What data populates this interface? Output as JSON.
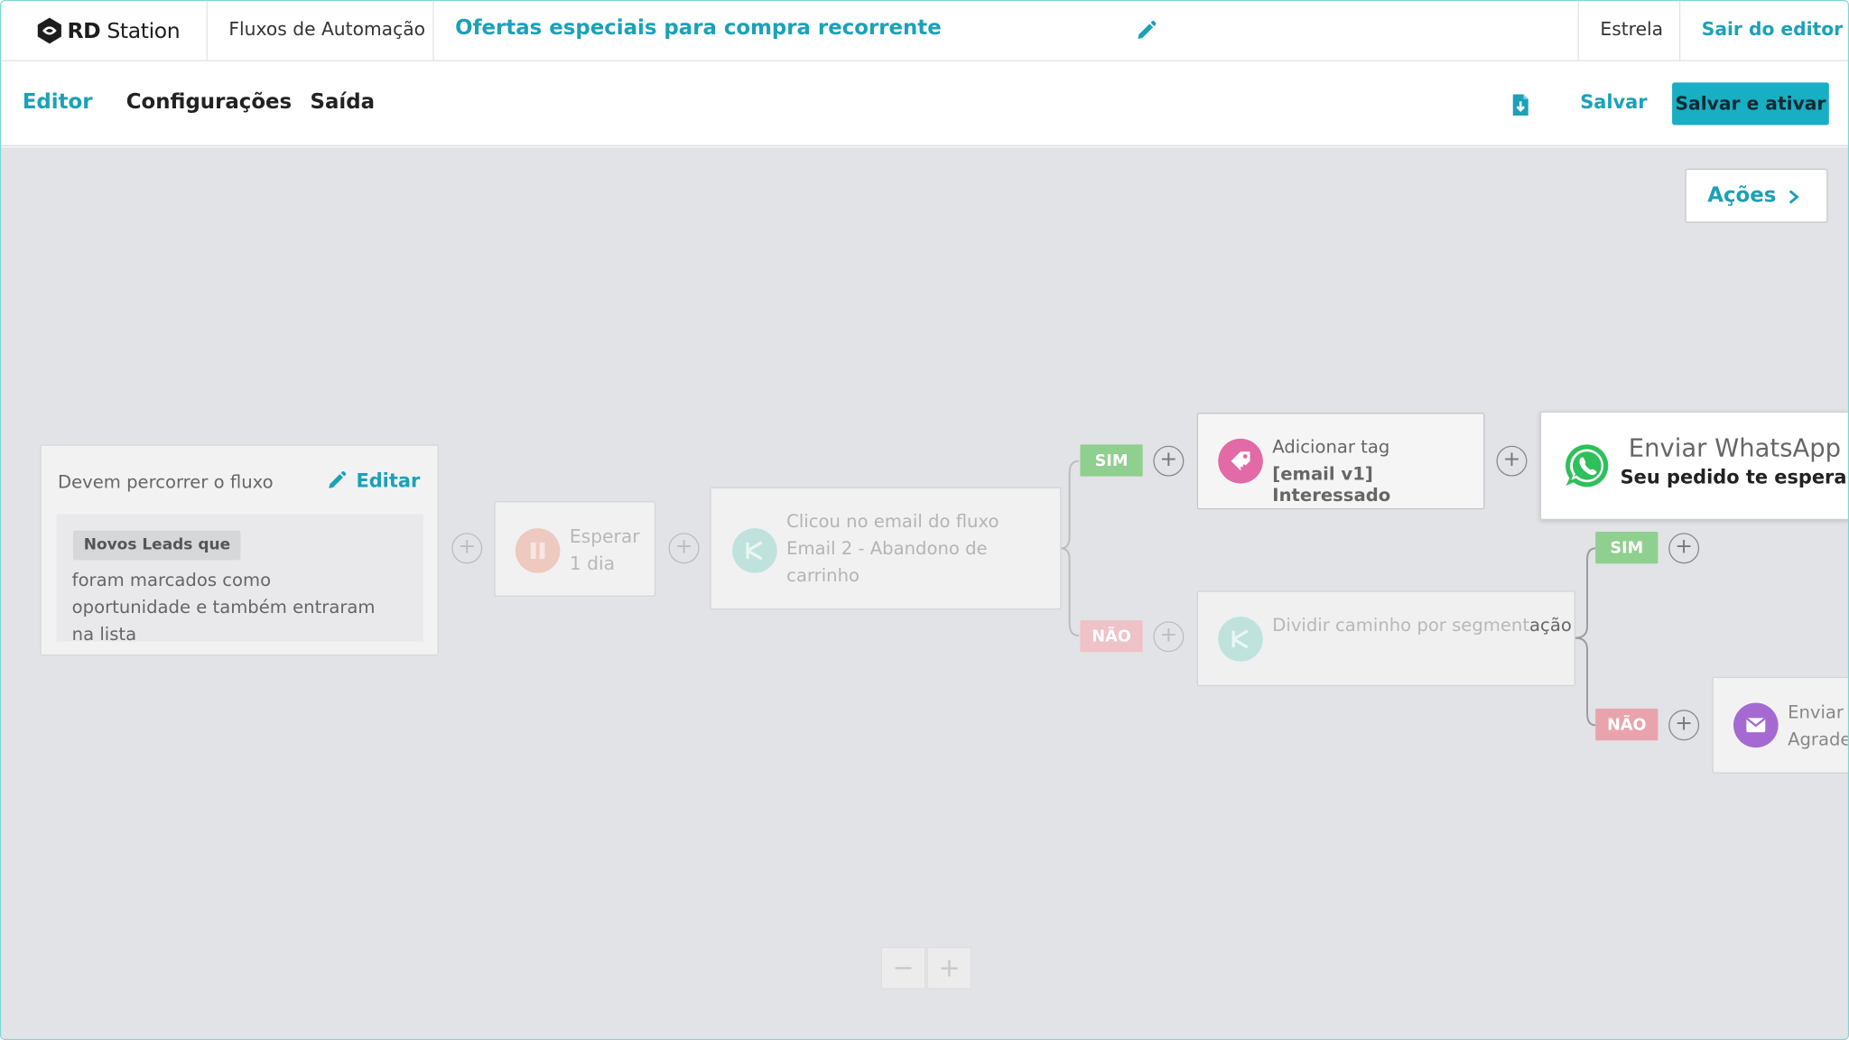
{
  "brand": {
    "name_bold": "RD",
    "name_rest": "Station"
  },
  "header": {
    "breadcrumb": "Fluxos de Automação",
    "flow_title": "Ofertas especiais para compra recorrente",
    "user": "Estrela",
    "exit_label": "Sair do editor"
  },
  "tabs": [
    {
      "label": "Editor",
      "active": true
    },
    {
      "label": "Configurações",
      "active": false
    },
    {
      "label": "Saída",
      "active": false
    }
  ],
  "toolbar": {
    "save_label": "Salvar",
    "save_activate_label": "Salvar e ativar",
    "download_icon": "download-file-icon"
  },
  "actions_button": "Ações",
  "trigger": {
    "heading": "Devem percorrer o fluxo",
    "edit_label": "Editar",
    "chip": "Novos Leads que",
    "description": "foram marcados como oportunidade e também entraram na lista"
  },
  "nodes": {
    "wait": {
      "line1": "Esperar",
      "line2": "1 dia"
    },
    "clicked": {
      "line1": "Clicou no email do fluxo",
      "line2": "Email 2 - Abandono de carrinho"
    },
    "tag": {
      "line1": "Adicionar tag",
      "line2": "[email v1] Interessado"
    },
    "whatsapp": {
      "line1": "Enviar WhatsApp",
      "line2": "Seu pedido te espera!"
    },
    "split": {
      "faded": "Dividir caminho por segment",
      "strong": "ação"
    },
    "email": {
      "line1": "Enviar E",
      "line2": "Agrade"
    }
  },
  "branches": {
    "yes": "SIM",
    "no": "NÃO"
  },
  "zoom": {
    "minus": "−",
    "plus": "+"
  },
  "colors": {
    "accent": "#1ba1b8",
    "primary_button": "#18aec3",
    "yes": "#8fcf8f",
    "no": "#e9a3ad",
    "canvas": "#e2e3e6"
  }
}
